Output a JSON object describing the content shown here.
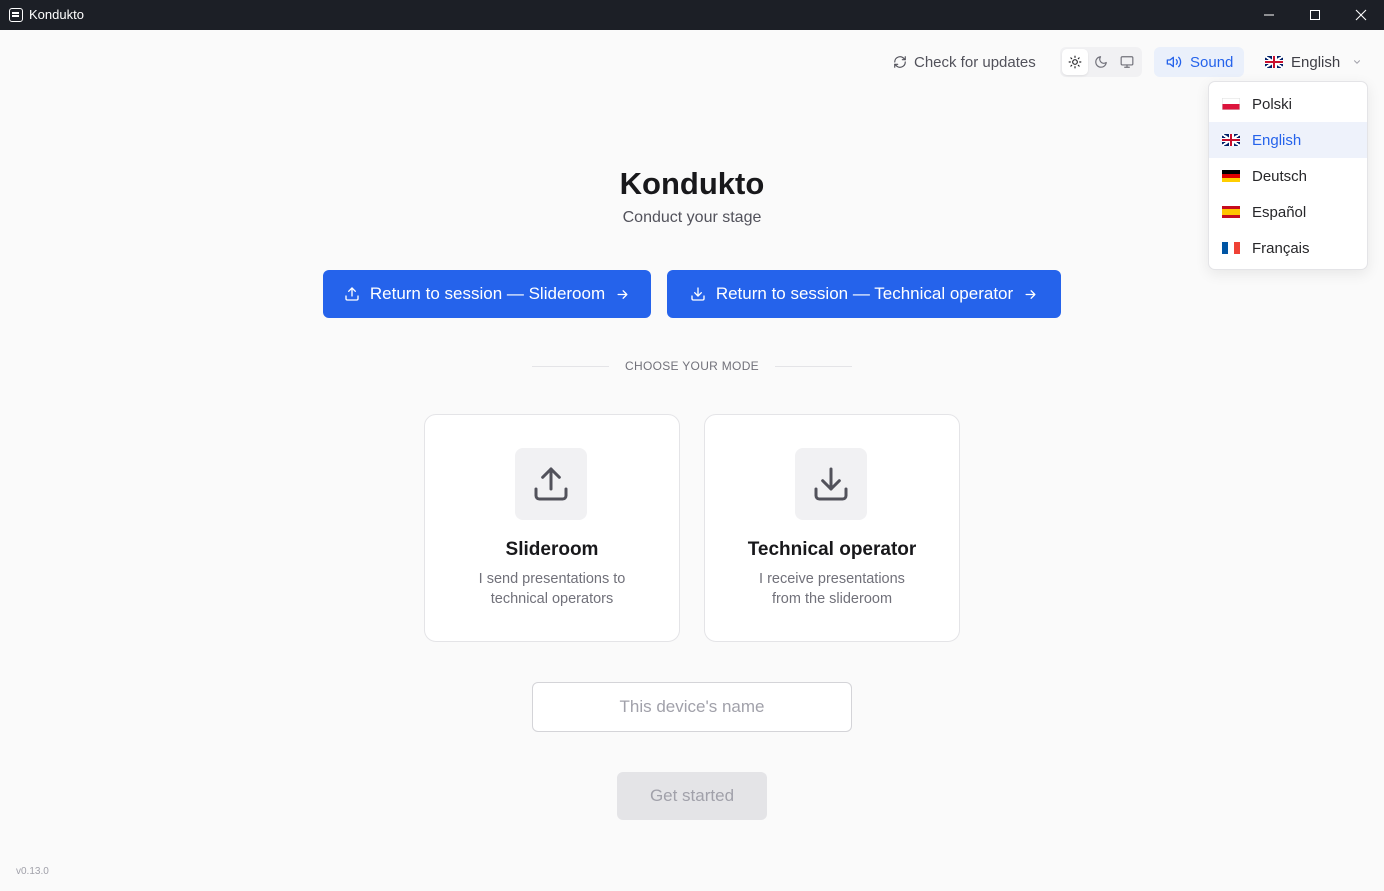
{
  "window": {
    "title": "Kondukto"
  },
  "topbar": {
    "check_updates": "Check for updates",
    "sound": "Sound",
    "language": "English"
  },
  "language_menu": [
    {
      "label": "Polski",
      "flag": "pl"
    },
    {
      "label": "English",
      "flag": "gb",
      "selected": true
    },
    {
      "label": "Deutsch",
      "flag": "de"
    },
    {
      "label": "Español",
      "flag": "es"
    },
    {
      "label": "Français",
      "flag": "fr"
    }
  ],
  "hero": {
    "title": "Kondukto",
    "subtitle": "Conduct your stage"
  },
  "return_buttons": {
    "slideroom": "Return to session — Slideroom",
    "technical": "Return to session — Technical operator"
  },
  "divider": "CHOOSE YOUR MODE",
  "modes": [
    {
      "title": "Slideroom",
      "description": "I send presentations to technical operators",
      "icon": "upload-icon"
    },
    {
      "title": "Technical operator",
      "description": "I receive presentations from the slideroom",
      "icon": "download-icon"
    }
  ],
  "device": {
    "placeholder": "This device's name",
    "value": ""
  },
  "get_started": "Get started",
  "version": "v0.13.0",
  "colors": {
    "accent": "#2563eb",
    "background": "#fafafa",
    "titlebar": "#1c1f26"
  }
}
